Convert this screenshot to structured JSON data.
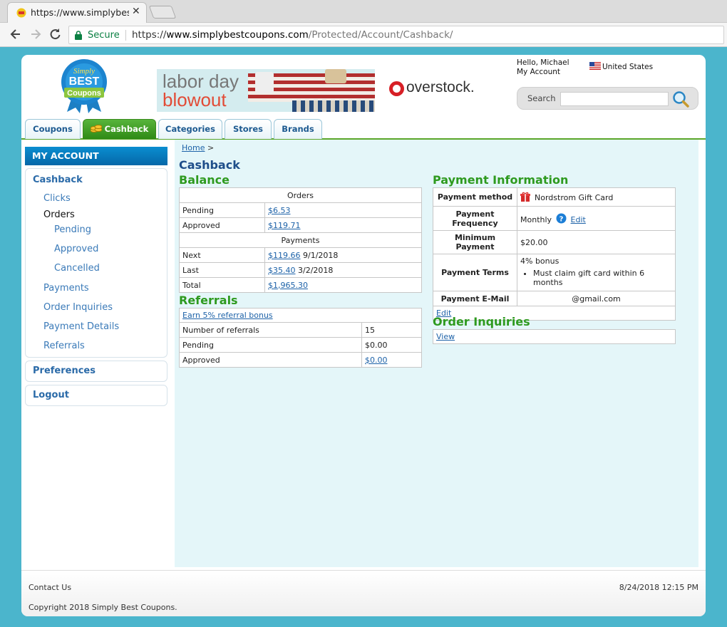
{
  "browser": {
    "tab_title": "https://www.simplybestcoupons.com/Protected/Account/Cashback/",
    "secure_label": "Secure",
    "url_scheme": "https://",
    "url_host": "www.simplybestcoupons.com",
    "url_path": "/Protected/Account/Cashback/"
  },
  "header": {
    "logo_alt": "Simply BEST Coupons",
    "banner_line1": "labor day",
    "banner_line2": "blowout",
    "overstock_text": "overstock.",
    "hello_text": "Hello, Michael",
    "my_account_link": "My Account",
    "country": "United States",
    "search_label": "Search",
    "search_placeholder": ""
  },
  "nav": {
    "tabs": [
      "Coupons",
      "Cashback",
      "Categories",
      "Stores",
      "Brands"
    ],
    "active": "Cashback"
  },
  "sidebar": {
    "heading": "MY ACCOUNT",
    "cashback": "Cashback",
    "clicks": "Clicks",
    "orders": "Orders",
    "pending": "Pending",
    "approved": "Approved",
    "cancelled": "Cancelled",
    "payments": "Payments",
    "order_inquiries": "Order Inquiries",
    "payment_details": "Payment Details",
    "referrals": "Referrals",
    "preferences": "Preferences",
    "logout": "Logout"
  },
  "content": {
    "breadcrumb_home": "Home",
    "breadcrumb_sep": ">",
    "title": "Cashback",
    "balance": {
      "heading": "Balance",
      "orders_header": "Orders",
      "pending_label": "Pending",
      "pending_value": "$6.53",
      "approved_label": "Approved",
      "approved_value": "$119.71",
      "payments_header": "Payments",
      "next_label": "Next",
      "next_value": "$119.66",
      "next_date": "9/1/2018",
      "last_label": "Last",
      "last_value": "$35.40",
      "last_date": "3/2/2018",
      "total_label": "Total",
      "total_value": "$1,965.30"
    },
    "referrals": {
      "heading": "Referrals",
      "earn_link": "Earn 5% referral bonus",
      "number_label": "Number of referrals",
      "number_value": "15",
      "pending_label": "Pending",
      "pending_value": "$0.00",
      "approved_label": "Approved",
      "approved_value": "$0.00"
    },
    "payment_info": {
      "heading": "Payment Information",
      "method_label": "Payment method",
      "method_value": "Nordstrom Gift Card",
      "frequency_label_1": "Payment",
      "frequency_label_2": "Frequency",
      "frequency_value": "Monthly",
      "frequency_edit": "Edit",
      "minimum_label": "Minimum Payment",
      "minimum_value": "$20.00",
      "terms_label": "Payment Terms",
      "terms_line": "4% bonus",
      "terms_bullet": "Must claim gift card within 6 months",
      "email_label": "Payment E-Mail",
      "email_value": "@gmail.com",
      "edit_link": "Edit"
    },
    "order_inquiries": {
      "heading": "Order Inquiries",
      "view_link": "View"
    }
  },
  "footer": {
    "contact": "Contact Us",
    "datetime": "8/24/2018 12:15 PM",
    "copyright": "Copyright 2018 Simply Best Coupons."
  },
  "colors": {
    "page_bg": "#4bb5cc",
    "content_bg": "#e4f6f9",
    "heading_green": "#2e9a1f",
    "link_blue": "#1d62a8",
    "active_tab": "#3d9d22"
  }
}
